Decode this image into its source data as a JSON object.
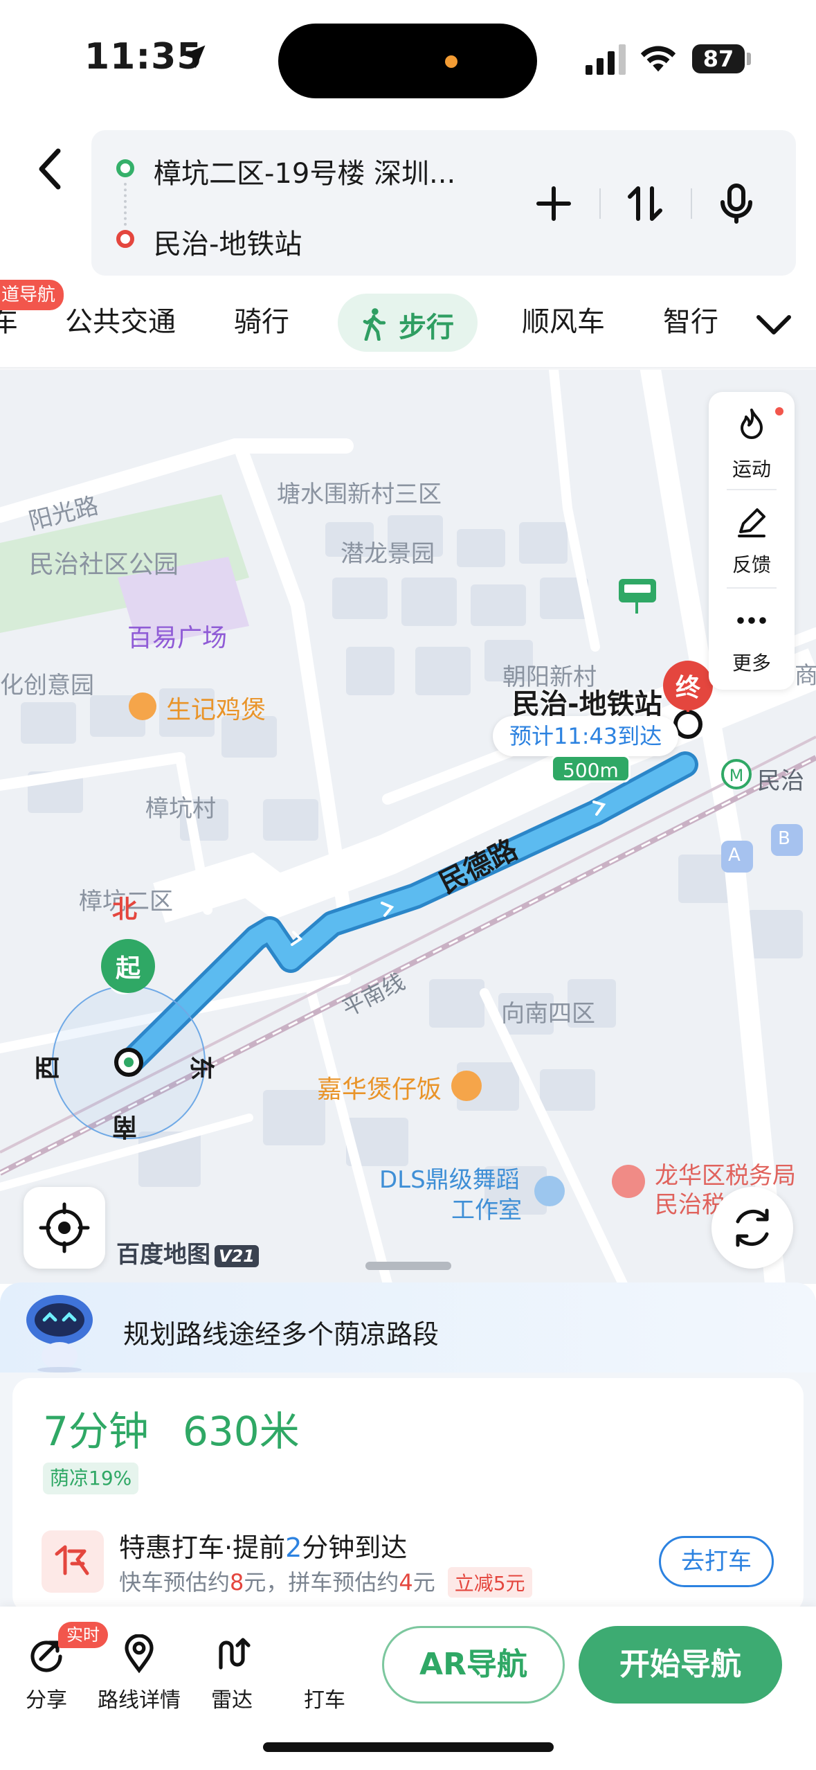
{
  "status_bar": {
    "time": "11:35",
    "battery": "87"
  },
  "route": {
    "from": "樟坑二区-19号楼 深圳...",
    "to": "民治-地铁站"
  },
  "modes": {
    "badge": "道导航",
    "items": [
      "车",
      "公共交通",
      "骑行",
      "步行",
      "顺风车",
      "智行"
    ],
    "active": "步行"
  },
  "map": {
    "labels": {
      "yangguang_road": "阳光路",
      "tangshuiwei": "塘水围新村三区",
      "qianlong": "潜龙景园",
      "minzhi_park": "民治社区公园",
      "baiyi": "百易广场",
      "creative_park": "化创意园",
      "shengji": "生记鸡煲",
      "zhangkeng_village": "樟坑村",
      "zhangkeng_2": "樟坑二区",
      "chaoyang": "朝阳新村",
      "xiangnan": "向南四区",
      "jiahua": "嘉华煲仔饭",
      "dls": "DLS鼎级舞蹈工作室",
      "dls_line1": "DLS鼎级舞蹈",
      "dls_line2": "工作室",
      "tax_line1": "龙华区税务局",
      "tax_line2": "民治税",
      "minzhi_metro": "民治",
      "edge_shang": "商"
    },
    "road_minde": "民德路",
    "rail_pingnan": "平南线",
    "destination": "民治-地铁站",
    "eta": "预计11:43到达",
    "distance_marker": "500m",
    "end_marker": "终",
    "start_marker": "起",
    "compass": {
      "n": "北",
      "e": "东",
      "s": "南",
      "w": "西"
    },
    "tools": [
      {
        "label": "运动",
        "icon": "flame-icon"
      },
      {
        "label": "反馈",
        "icon": "edit-icon"
      },
      {
        "label": "更多",
        "icon": "more-icon"
      }
    ],
    "brand": "百度地图",
    "brand_version": "V21",
    "exit_a": "A",
    "exit_b": "B"
  },
  "sheet": {
    "shade_banner": "规划路线途经多个荫凉路段",
    "time": "7分钟",
    "distance": "630米",
    "shade_tag": "荫凉19%",
    "taxi": {
      "title_a": "特惠打车·提前",
      "title_num": "2",
      "title_b": "分钟到达",
      "sub_a": "快车预估约",
      "sub_price1": "8",
      "sub_b": "元，拼车预估约",
      "sub_price2": "4",
      "sub_c": "元",
      "discount": "立减5元",
      "button": "去打车"
    }
  },
  "toolbar": {
    "live_badge": "实时",
    "share": "分享",
    "details": "路线详情",
    "radar": "雷达",
    "taxi": "打车",
    "ar": "AR导航",
    "go": "开始导航"
  },
  "colors": {
    "accent_green": "#2fa865",
    "route_blue": "#4aa6e8",
    "end_red": "#e4463e",
    "link_blue": "#2c82e0"
  }
}
